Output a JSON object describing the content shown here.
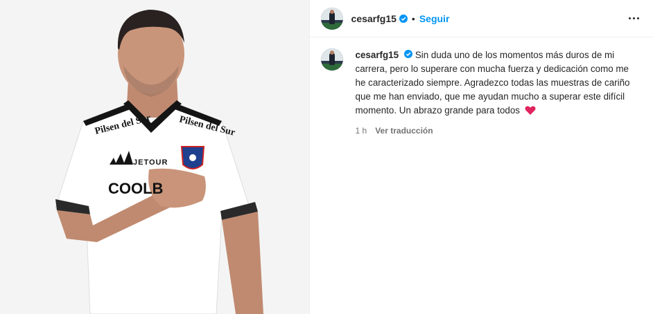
{
  "post": {
    "author": {
      "username": "cesarfg15",
      "verified": true
    },
    "header": {
      "separator": "•",
      "follow_label": "Seguir",
      "more_icon": "more-horizontal-icon"
    },
    "caption": {
      "username": "cesarfg15",
      "text": "Sin duda uno de los momentos más duros de mi carrera, pero lo superare con mucha fuerza y dedicación como me he caracterizado siempre. Agradezco todas las muestras de cariño que me han enviado, que me ayudan mucho a superar este difícil momento. Un abrazo grande para todos",
      "emoji": "red-heart-icon"
    },
    "meta": {
      "time": "1 h",
      "translate_label": "Ver traducción"
    },
    "photo": {
      "jersey_sponsor_top": "Pilsen del Sur",
      "jersey_sponsor_chest": "JETOUR",
      "jersey_sponsor_main": "COOLB"
    },
    "colors": {
      "accent": "#0095f6",
      "verified": "#0095f6",
      "heart": "#e0245e"
    }
  }
}
